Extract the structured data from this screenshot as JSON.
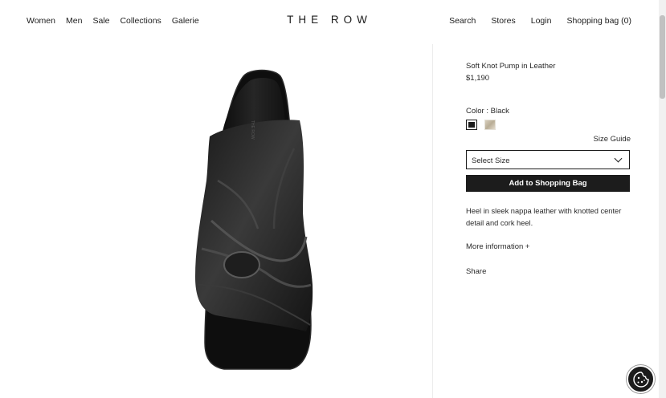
{
  "header": {
    "nav_left": [
      "Women",
      "Men",
      "Sale",
      "Collections",
      "Galerie"
    ],
    "logo": "THE ROW",
    "nav_right": [
      "Search",
      "Stores",
      "Login",
      "Shopping bag (0)"
    ]
  },
  "product": {
    "name": "Soft Knot Pump in Leather",
    "price": "$1,190",
    "color_label": "Color : Black",
    "swatches": [
      {
        "name": "black",
        "color": "#1c1c1c",
        "selected": true
      },
      {
        "name": "sand",
        "color": "#c9bfa9",
        "selected": false
      }
    ],
    "size_guide": "Size Guide",
    "size_select": "Select Size",
    "add_to_bag": "Add to Shopping Bag",
    "description": "Heel in sleek nappa leather with knotted center detail and cork heel.",
    "more_info": "More information +",
    "share": "Share"
  },
  "image": {
    "icon": "black-knot-sandal-product-photo"
  },
  "cookie": {
    "icon": "cookie-settings-icon"
  },
  "colors": {
    "text": "#1c1c1c",
    "button_bg": "#1c1c1c",
    "button_text": "#ffffff"
  }
}
